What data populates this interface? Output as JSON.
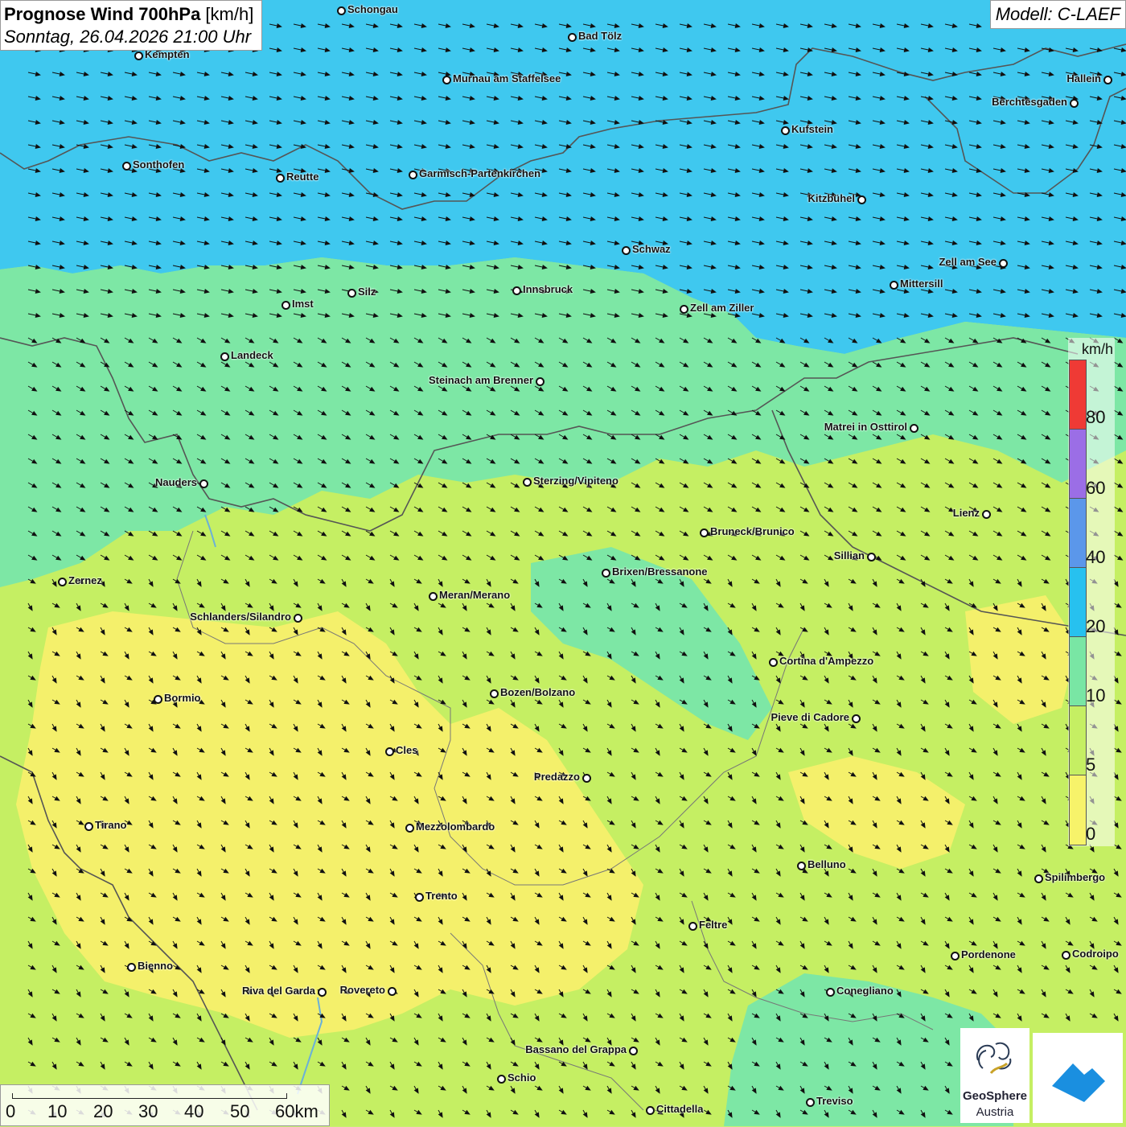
{
  "title": {
    "main_bold": "Prognose Wind 700hPa",
    "main_unit": " [km/h]",
    "subtitle": "Sonntag, 26.04.2026 21:00 Uhr"
  },
  "model": "Modell: C-LAEF",
  "legend": {
    "unit": "km/h",
    "labels": [
      "80",
      "60",
      "40",
      "20",
      "10",
      "5",
      "0"
    ],
    "colors": {
      "0-5": "#f7f36a",
      "5-10": "#c5ef63",
      "10-20": "#79e6a4",
      "20-40": "#27c1ef",
      "40-60": "#5b97ea",
      "60-80": "#9b6ee6",
      "80+": "#ef3a35"
    }
  },
  "scale_bar": {
    "labels": [
      "0",
      "10",
      "20",
      "30",
      "40",
      "50",
      "60km"
    ]
  },
  "logos": {
    "geosphere_line1": "GeoSphere",
    "geosphere_line2": "Austria"
  },
  "cities": [
    {
      "name": "Schongau"
    },
    {
      "name": "Bad Tölz"
    },
    {
      "name": "Kempten"
    },
    {
      "name": "Murnau am Staffelsee"
    },
    {
      "name": "Hallein"
    },
    {
      "name": "Berchtesgaden"
    },
    {
      "name": "Kufstein"
    },
    {
      "name": "Sonthofen"
    },
    {
      "name": "Reutte"
    },
    {
      "name": "Garmisch-Partenkirchen"
    },
    {
      "name": "Kitzbühel"
    },
    {
      "name": "Schwaz"
    },
    {
      "name": "Zell am See"
    },
    {
      "name": "Mittersill"
    },
    {
      "name": "Innsbruck"
    },
    {
      "name": "Silz"
    },
    {
      "name": "Imst"
    },
    {
      "name": "Zell am Ziller"
    },
    {
      "name": "Landeck"
    },
    {
      "name": "Steinach am Brenner"
    },
    {
      "name": "Matrei in Osttirol"
    },
    {
      "name": "Nauders"
    },
    {
      "name": "Sterzing/Vipiteno"
    },
    {
      "name": "Lienz"
    },
    {
      "name": "Bruneck/Brunico"
    },
    {
      "name": "Sillian"
    },
    {
      "name": "Brixen/Bressanone"
    },
    {
      "name": "Zernez"
    },
    {
      "name": "Meran/Merano"
    },
    {
      "name": "Schlanders/Silandro"
    },
    {
      "name": "Cortina d'Ampezzo"
    },
    {
      "name": "Bormio"
    },
    {
      "name": "Bozen/Bolzano"
    },
    {
      "name": "Pieve di Cadore"
    },
    {
      "name": "Cles"
    },
    {
      "name": "Predazzo"
    },
    {
      "name": "Tirano"
    },
    {
      "name": "Mezzolombardo"
    },
    {
      "name": "Belluno"
    },
    {
      "name": "Spilimbergo"
    },
    {
      "name": "Trento"
    },
    {
      "name": "Feltre"
    },
    {
      "name": "Pordenone"
    },
    {
      "name": "Codroipo"
    },
    {
      "name": "Bienno"
    },
    {
      "name": "Riva del Garda"
    },
    {
      "name": "Rovereto"
    },
    {
      "name": "Conegliano"
    },
    {
      "name": "Bassano del Grappa"
    },
    {
      "name": "Schio"
    },
    {
      "name": "Treviso"
    },
    {
      "name": "Cittadella"
    }
  ]
}
